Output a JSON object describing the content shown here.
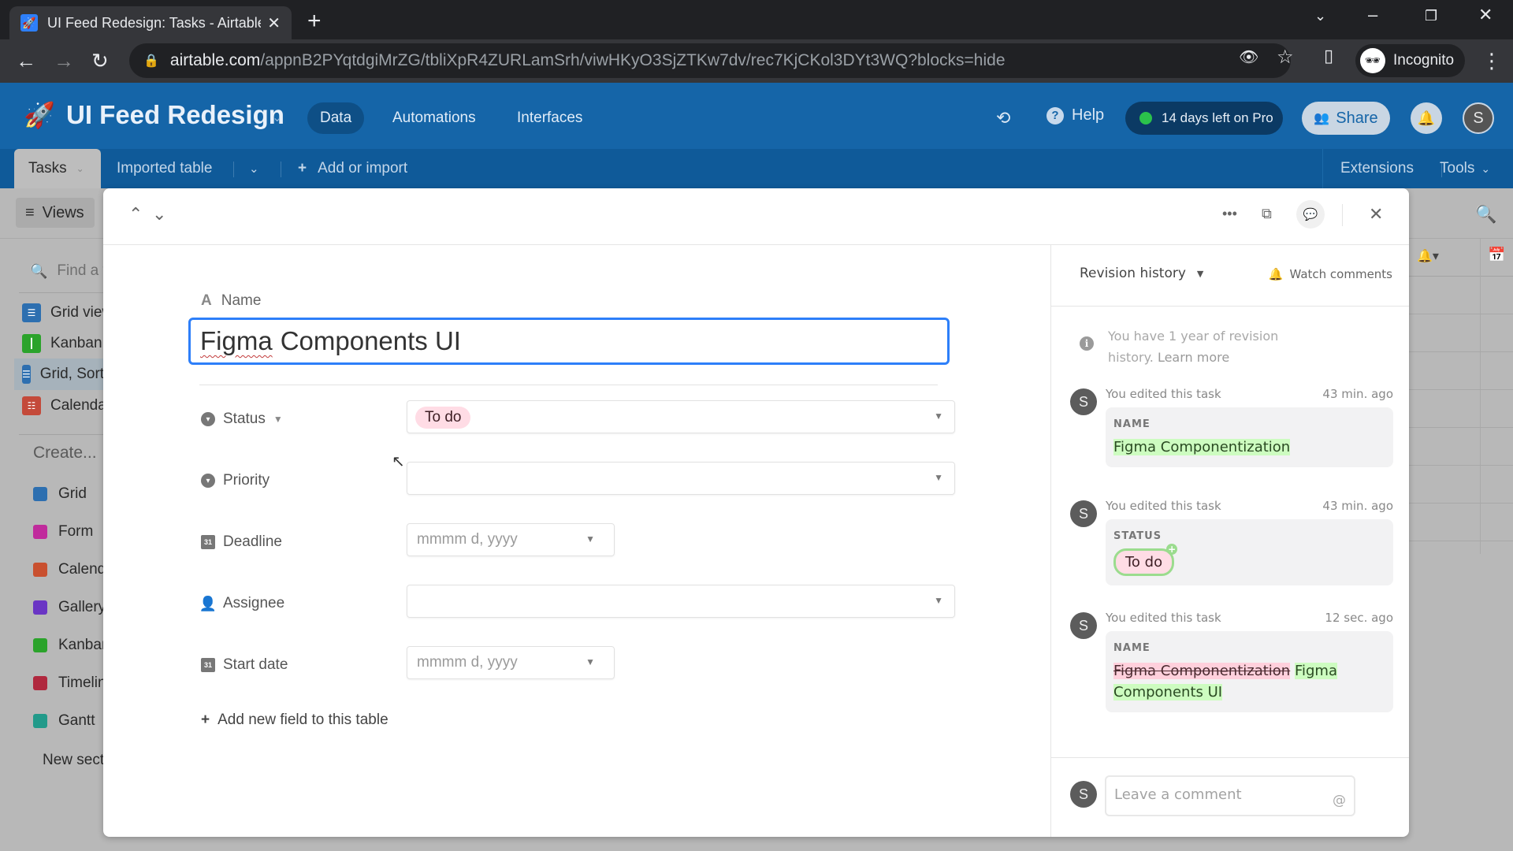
{
  "browser": {
    "tab_title": "UI Feed Redesign: Tasks - Airtable",
    "url_host": "airtable.com",
    "url_path": "/appnB2PYqtdgiMrZG/tbliXpR4ZURLamSrh/viwHKyO3SjZTKw7dv/rec7KjCKol3DYt3WQ?blocks=hide",
    "profile_label": "Incognito"
  },
  "app": {
    "base_name": "UI Feed Redesign",
    "nav": [
      "Data",
      "Automations",
      "Interfaces"
    ],
    "active_nav": "Data",
    "help_label": "Help",
    "trial_badge": "14 days left on Pro",
    "share_label": "Share",
    "user_initial": "S",
    "colors": {
      "header_bg": "#1565a8",
      "accent": "#2d7ff9",
      "trial_dot": "#2bc24b"
    }
  },
  "table_bar": {
    "active_table": "Tasks",
    "tables": [
      "Imported table"
    ],
    "add_label": "Add or import",
    "extensions_label": "Extensions",
    "tools_label": "Tools"
  },
  "sidebar": {
    "views_label": "Views",
    "find_placeholder": "Find a view",
    "views": [
      {
        "label": "Grid view",
        "icon": "grid-icon",
        "color": "#2d6fb0"
      },
      {
        "label": "Kanban",
        "icon": "kanban-icon",
        "color": "#2ba32b"
      },
      {
        "label": "Grid, Sorted",
        "icon": "grid-icon",
        "color": "#2d6fb0",
        "selected": true
      },
      {
        "label": "Calendar",
        "icon": "calendar-icon",
        "color": "#c44a3a"
      }
    ],
    "create_label": "Create...",
    "create_items": [
      {
        "label": "Grid",
        "color": "#2d6fb0"
      },
      {
        "label": "Form",
        "color": "#c02b9c"
      },
      {
        "label": "Calendar",
        "color": "#c9502f"
      },
      {
        "label": "Gallery",
        "color": "#6a35c4"
      },
      {
        "label": "Kanban",
        "color": "#2ba32b"
      },
      {
        "label": "Timeline",
        "color": "#b0283e"
      },
      {
        "label": "Gantt",
        "color": "#229a8a"
      }
    ],
    "new_section_label": "New section"
  },
  "record": {
    "name_label": "Name",
    "name_value_first": "Figma",
    "name_value_rest": "Components UI",
    "fields": [
      {
        "label": "Status",
        "type": "single-select",
        "value": "To do"
      },
      {
        "label": "Priority",
        "type": "single-select",
        "value": ""
      },
      {
        "label": "Deadline",
        "type": "date",
        "placeholder": "mmmm d, yyyy"
      },
      {
        "label": "Assignee",
        "type": "user",
        "value": ""
      },
      {
        "label": "Start date",
        "type": "date",
        "placeholder": "mmmm d, yyyy"
      }
    ],
    "add_field_label": "Add new field to this table"
  },
  "activity": {
    "selector_label": "Revision history",
    "watch_label": "Watch comments",
    "info_text": "You have 1 year of revision history.",
    "info_link": "Learn more",
    "entries": [
      {
        "who": "You edited this task",
        "when": "43 min. ago",
        "field": "NAME",
        "added": "Figma Componentization"
      },
      {
        "who": "You edited this task",
        "when": "43 min. ago",
        "field": "STATUS",
        "added_pill": "To do"
      },
      {
        "who": "You edited this task",
        "when": "12 sec. ago",
        "field": "NAME",
        "removed": "Figma Componentization",
        "added": "Figma Components UI"
      }
    ],
    "avatar_initial": "S",
    "comment_placeholder": "Leave a comment"
  }
}
